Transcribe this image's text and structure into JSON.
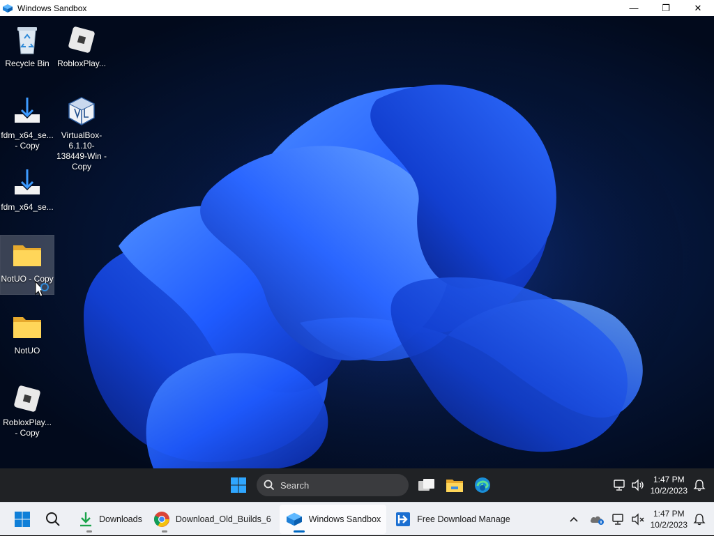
{
  "window": {
    "title": "Windows Sandbox",
    "minimize_glyph": "—",
    "restore_glyph": "❐",
    "close_glyph": "✕"
  },
  "desktop": {
    "icons": [
      {
        "label": "Recycle Bin",
        "icon": "recycle-bin-icon"
      },
      {
        "label": "RobloxPlay...",
        "icon": "roblox-icon"
      },
      {
        "label": "fdm_x64_se... - Copy",
        "icon": "download-installer-icon"
      },
      {
        "label": "VirtualBox-6.1.10-138449-Win - Copy",
        "icon": "virtualbox-icon"
      },
      {
        "label": "fdm_x64_se...",
        "icon": "download-installer-icon"
      },
      {
        "label": "NotUO - Copy",
        "icon": "folder-icon",
        "selected": true
      },
      {
        "label": "NotUO",
        "icon": "folder-icon"
      },
      {
        "label": "RobloxPlay... - Copy",
        "icon": "roblox-icon"
      }
    ]
  },
  "inner_taskbar": {
    "search_placeholder": "Search",
    "clock_time": "1:47 PM",
    "clock_date": "10/2/2023"
  },
  "host_taskbar": {
    "apps": [
      {
        "label": "Downloads",
        "icon": "download-arrow-icon"
      },
      {
        "label": "Download_Old_Builds_6",
        "icon": "chrome-icon"
      },
      {
        "label": "Windows Sandbox",
        "icon": "sandbox-icon",
        "active": true
      },
      {
        "label": "Free Download Manage",
        "icon": "fdm-icon"
      }
    ],
    "clock_time": "1:47 PM",
    "clock_date": "10/2/2023"
  },
  "colors": {
    "accent": "#0067c0",
    "wallpaper_bloom": "#1f5bff",
    "inner_taskbar_bg": "#202225",
    "host_taskbar_bg": "#eef0f4"
  }
}
